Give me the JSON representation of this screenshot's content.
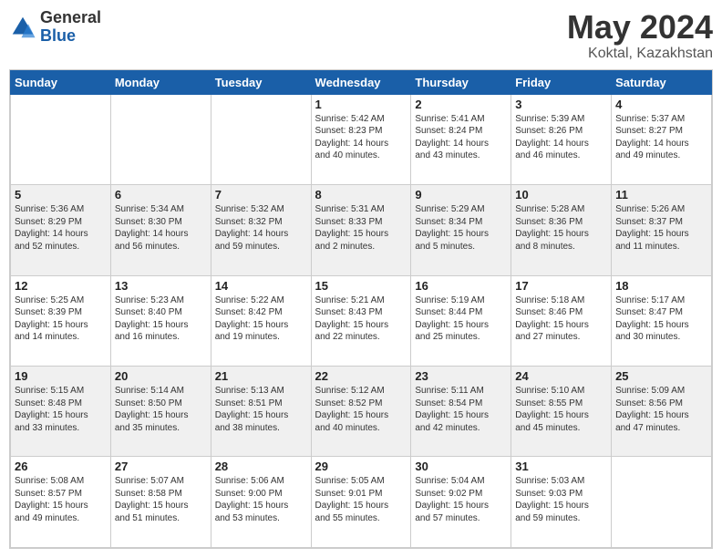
{
  "logo": {
    "general": "General",
    "blue": "Blue"
  },
  "title": "May 2024",
  "location": "Koktal, Kazakhstan",
  "days_header": [
    "Sunday",
    "Monday",
    "Tuesday",
    "Wednesday",
    "Thursday",
    "Friday",
    "Saturday"
  ],
  "weeks": [
    [
      {
        "num": "",
        "info": ""
      },
      {
        "num": "",
        "info": ""
      },
      {
        "num": "",
        "info": ""
      },
      {
        "num": "1",
        "info": "Sunrise: 5:42 AM\nSunset: 8:23 PM\nDaylight: 14 hours\nand 40 minutes."
      },
      {
        "num": "2",
        "info": "Sunrise: 5:41 AM\nSunset: 8:24 PM\nDaylight: 14 hours\nand 43 minutes."
      },
      {
        "num": "3",
        "info": "Sunrise: 5:39 AM\nSunset: 8:26 PM\nDaylight: 14 hours\nand 46 minutes."
      },
      {
        "num": "4",
        "info": "Sunrise: 5:37 AM\nSunset: 8:27 PM\nDaylight: 14 hours\nand 49 minutes."
      }
    ],
    [
      {
        "num": "5",
        "info": "Sunrise: 5:36 AM\nSunset: 8:29 PM\nDaylight: 14 hours\nand 52 minutes."
      },
      {
        "num": "6",
        "info": "Sunrise: 5:34 AM\nSunset: 8:30 PM\nDaylight: 14 hours\nand 56 minutes."
      },
      {
        "num": "7",
        "info": "Sunrise: 5:32 AM\nSunset: 8:32 PM\nDaylight: 14 hours\nand 59 minutes."
      },
      {
        "num": "8",
        "info": "Sunrise: 5:31 AM\nSunset: 8:33 PM\nDaylight: 15 hours\nand 2 minutes."
      },
      {
        "num": "9",
        "info": "Sunrise: 5:29 AM\nSunset: 8:34 PM\nDaylight: 15 hours\nand 5 minutes."
      },
      {
        "num": "10",
        "info": "Sunrise: 5:28 AM\nSunset: 8:36 PM\nDaylight: 15 hours\nand 8 minutes."
      },
      {
        "num": "11",
        "info": "Sunrise: 5:26 AM\nSunset: 8:37 PM\nDaylight: 15 hours\nand 11 minutes."
      }
    ],
    [
      {
        "num": "12",
        "info": "Sunrise: 5:25 AM\nSunset: 8:39 PM\nDaylight: 15 hours\nand 14 minutes."
      },
      {
        "num": "13",
        "info": "Sunrise: 5:23 AM\nSunset: 8:40 PM\nDaylight: 15 hours\nand 16 minutes."
      },
      {
        "num": "14",
        "info": "Sunrise: 5:22 AM\nSunset: 8:42 PM\nDaylight: 15 hours\nand 19 minutes."
      },
      {
        "num": "15",
        "info": "Sunrise: 5:21 AM\nSunset: 8:43 PM\nDaylight: 15 hours\nand 22 minutes."
      },
      {
        "num": "16",
        "info": "Sunrise: 5:19 AM\nSunset: 8:44 PM\nDaylight: 15 hours\nand 25 minutes."
      },
      {
        "num": "17",
        "info": "Sunrise: 5:18 AM\nSunset: 8:46 PM\nDaylight: 15 hours\nand 27 minutes."
      },
      {
        "num": "18",
        "info": "Sunrise: 5:17 AM\nSunset: 8:47 PM\nDaylight: 15 hours\nand 30 minutes."
      }
    ],
    [
      {
        "num": "19",
        "info": "Sunrise: 5:15 AM\nSunset: 8:48 PM\nDaylight: 15 hours\nand 33 minutes."
      },
      {
        "num": "20",
        "info": "Sunrise: 5:14 AM\nSunset: 8:50 PM\nDaylight: 15 hours\nand 35 minutes."
      },
      {
        "num": "21",
        "info": "Sunrise: 5:13 AM\nSunset: 8:51 PM\nDaylight: 15 hours\nand 38 minutes."
      },
      {
        "num": "22",
        "info": "Sunrise: 5:12 AM\nSunset: 8:52 PM\nDaylight: 15 hours\nand 40 minutes."
      },
      {
        "num": "23",
        "info": "Sunrise: 5:11 AM\nSunset: 8:54 PM\nDaylight: 15 hours\nand 42 minutes."
      },
      {
        "num": "24",
        "info": "Sunrise: 5:10 AM\nSunset: 8:55 PM\nDaylight: 15 hours\nand 45 minutes."
      },
      {
        "num": "25",
        "info": "Sunrise: 5:09 AM\nSunset: 8:56 PM\nDaylight: 15 hours\nand 47 minutes."
      }
    ],
    [
      {
        "num": "26",
        "info": "Sunrise: 5:08 AM\nSunset: 8:57 PM\nDaylight: 15 hours\nand 49 minutes."
      },
      {
        "num": "27",
        "info": "Sunrise: 5:07 AM\nSunset: 8:58 PM\nDaylight: 15 hours\nand 51 minutes."
      },
      {
        "num": "28",
        "info": "Sunrise: 5:06 AM\nSunset: 9:00 PM\nDaylight: 15 hours\nand 53 minutes."
      },
      {
        "num": "29",
        "info": "Sunrise: 5:05 AM\nSunset: 9:01 PM\nDaylight: 15 hours\nand 55 minutes."
      },
      {
        "num": "30",
        "info": "Sunrise: 5:04 AM\nSunset: 9:02 PM\nDaylight: 15 hours\nand 57 minutes."
      },
      {
        "num": "31",
        "info": "Sunrise: 5:03 AM\nSunset: 9:03 PM\nDaylight: 15 hours\nand 59 minutes."
      },
      {
        "num": "",
        "info": ""
      }
    ]
  ]
}
